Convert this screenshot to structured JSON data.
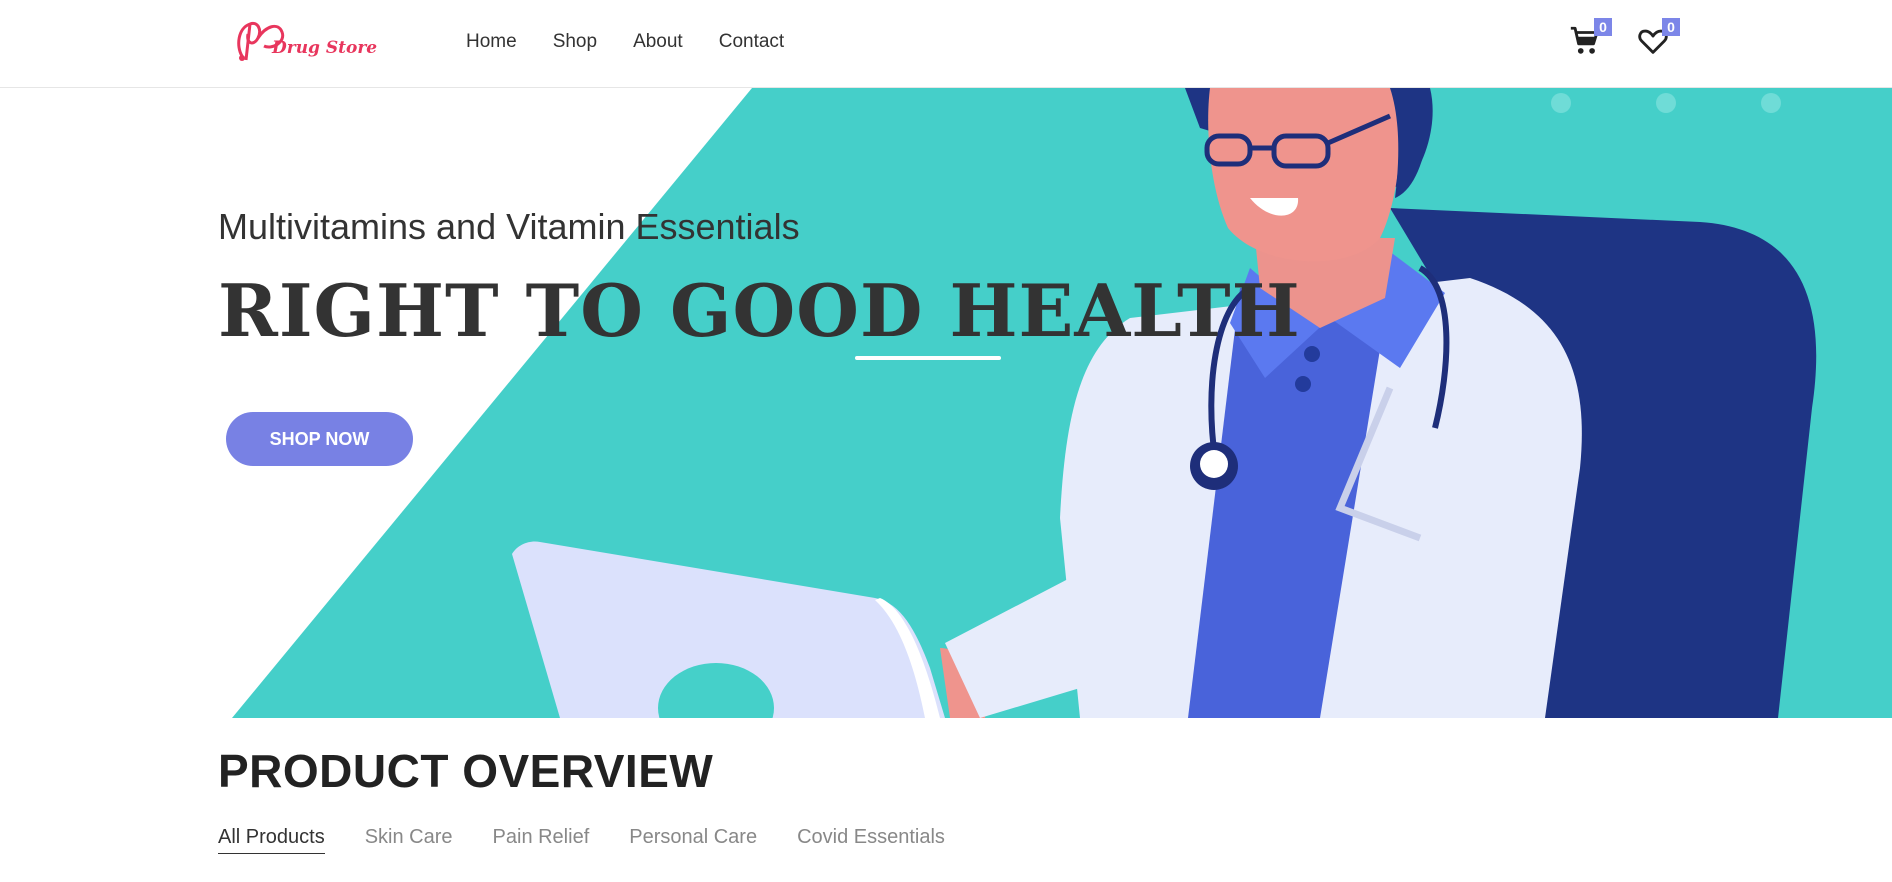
{
  "brand": {
    "name": "Drug Store",
    "color": "#e8365d"
  },
  "nav": {
    "items": [
      {
        "label": "Home"
      },
      {
        "label": "Shop"
      },
      {
        "label": "About"
      },
      {
        "label": "Contact"
      }
    ]
  },
  "header": {
    "cart": {
      "icon": "cart-icon",
      "count": "0"
    },
    "wishlist": {
      "icon": "heart-icon",
      "count": "0"
    },
    "badge_color": "#7c86e8"
  },
  "hero": {
    "subtitle": "Multivitamins and Vitamin Essentials",
    "title": "RIGHT TO GOOD HEALTH",
    "cta_label": "SHOP NOW",
    "colors": {
      "teal": "#45cfc9",
      "navy": "#1e3484",
      "button": "#7881e4"
    }
  },
  "products": {
    "title": "PRODUCT OVERVIEW",
    "filters": [
      {
        "label": "All Products",
        "active": true
      },
      {
        "label": "Skin Care",
        "active": false
      },
      {
        "label": "Pain Relief",
        "active": false
      },
      {
        "label": "Personal Care",
        "active": false
      },
      {
        "label": "Covid Essentials",
        "active": false
      }
    ]
  }
}
